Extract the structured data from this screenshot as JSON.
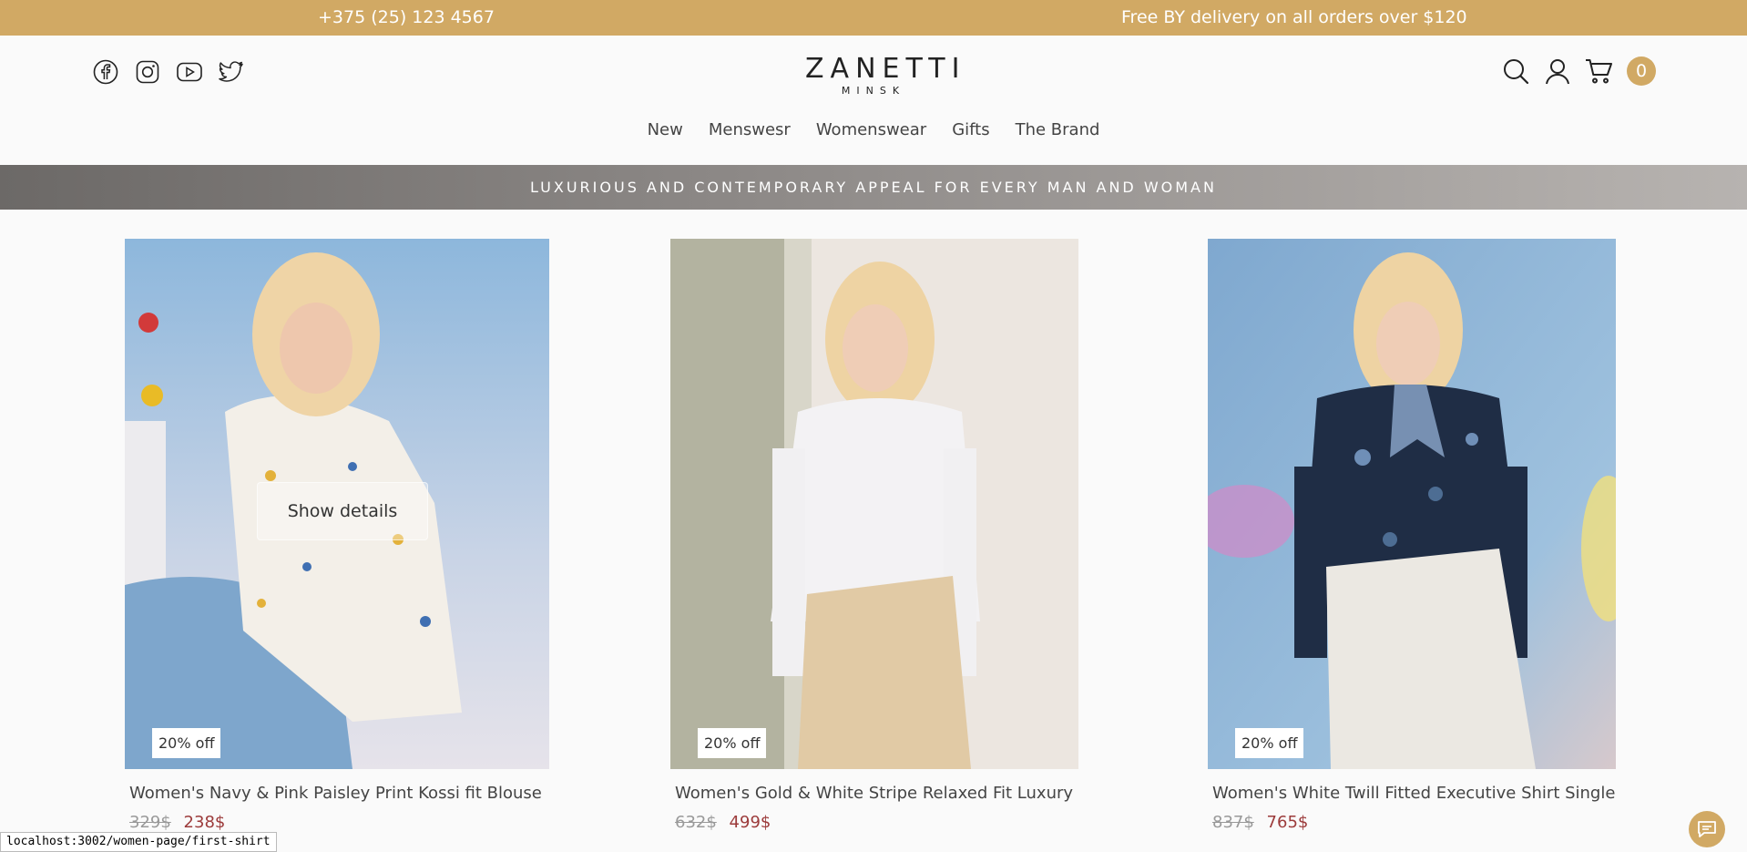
{
  "topbar": {
    "phone": "+375 (25) 123 4567",
    "promo": "Free BY delivery on all orders over $120"
  },
  "header": {
    "socials": [
      "facebook-icon",
      "instagram-icon",
      "youtube-icon",
      "twitter-icon"
    ],
    "logo_name": "ZANETTI",
    "logo_city": "MINSK",
    "actions": [
      "search-icon",
      "user-icon",
      "cart-icon"
    ],
    "cart_count": "0"
  },
  "nav": {
    "items": [
      "New",
      "Menswesr",
      "Womenswear",
      "Gifts",
      "The Brand"
    ]
  },
  "banner": {
    "text": "LUXURIOUS AND CONTEMPORARY APPEAL FOR EVERY MAN AND WOMAN"
  },
  "products": [
    {
      "title": "Women's Navy & Pink Paisley Print Kossi fit Blouse",
      "old_price": "329$",
      "new_price": "238$",
      "discount": "20% off",
      "hover_label": "Show details"
    },
    {
      "title": "Women's Gold & White Stripe Relaxed Fit Luxury",
      "old_price": "632$",
      "new_price": "499$",
      "discount": "20% off"
    },
    {
      "title": "Women's White Twill Fitted Executive Shirt Single",
      "old_price": "837$",
      "new_price": "765$",
      "discount": "20% off"
    }
  ],
  "status_bar": {
    "url": "localhost:3002/women-page/first-shirt"
  },
  "colors": {
    "accent": "#d1a964",
    "price_sale": "#9c3b3b",
    "banner": "#8b8785"
  },
  "chat": {
    "icon": "chat-icon"
  }
}
